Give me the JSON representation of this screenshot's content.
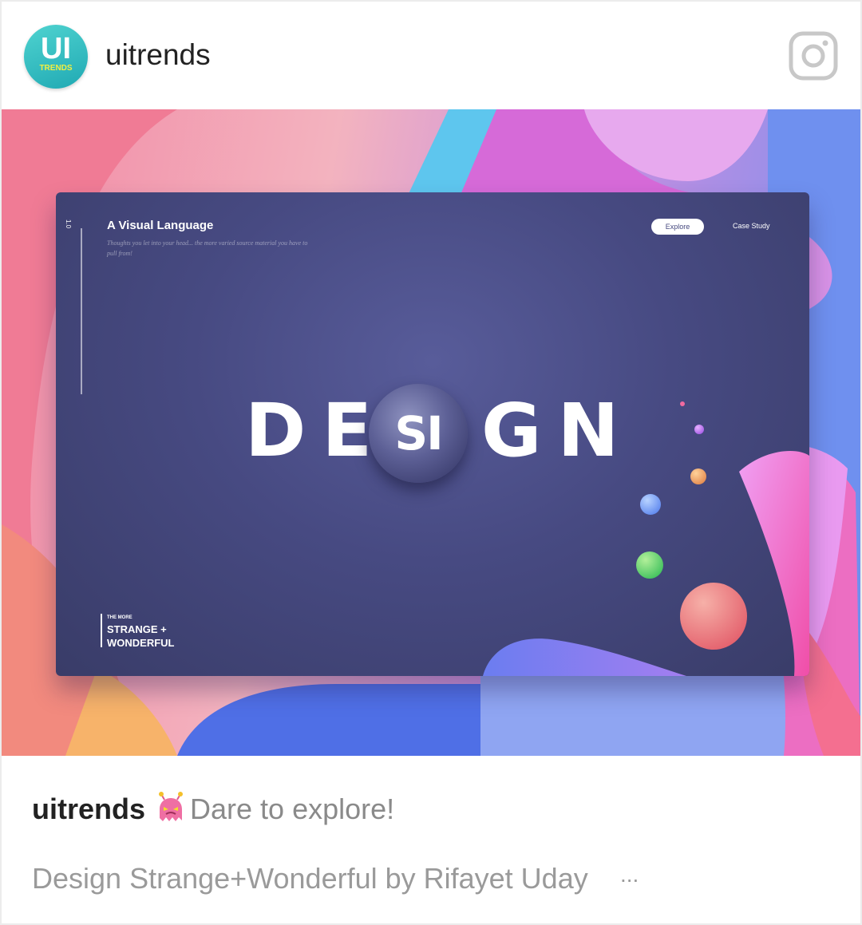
{
  "post": {
    "username": "uitrends",
    "avatar_initials": "UI",
    "avatar_subtext": "TRENDS"
  },
  "header": {
    "icon": "instagram-icon"
  },
  "image": {
    "title": "A Visual Language",
    "subtitle": "Thoughts you let into your head... the more varied source material you have to pull from!",
    "explore_label": "Explore",
    "case_study_label": "Case Study",
    "big_left": "DE",
    "bubble_text": "SI",
    "big_right": "GN",
    "slide_number": "1.0",
    "corner_small": "THE MORE",
    "corner_line1": "STRANGE +",
    "corner_line2": "WONDERFUL"
  },
  "caption": {
    "username": "uitrends",
    "emoji": "alien-monster-emoji",
    "text": "Dare to explore!",
    "line2": "Design Strange+Wonderful by Rifayet Uday",
    "more": "..."
  },
  "colors": {
    "avatar": "#2fb8be",
    "screen": "#46497f",
    "username": "#222222",
    "caption_gray": "#8a8a8a"
  }
}
